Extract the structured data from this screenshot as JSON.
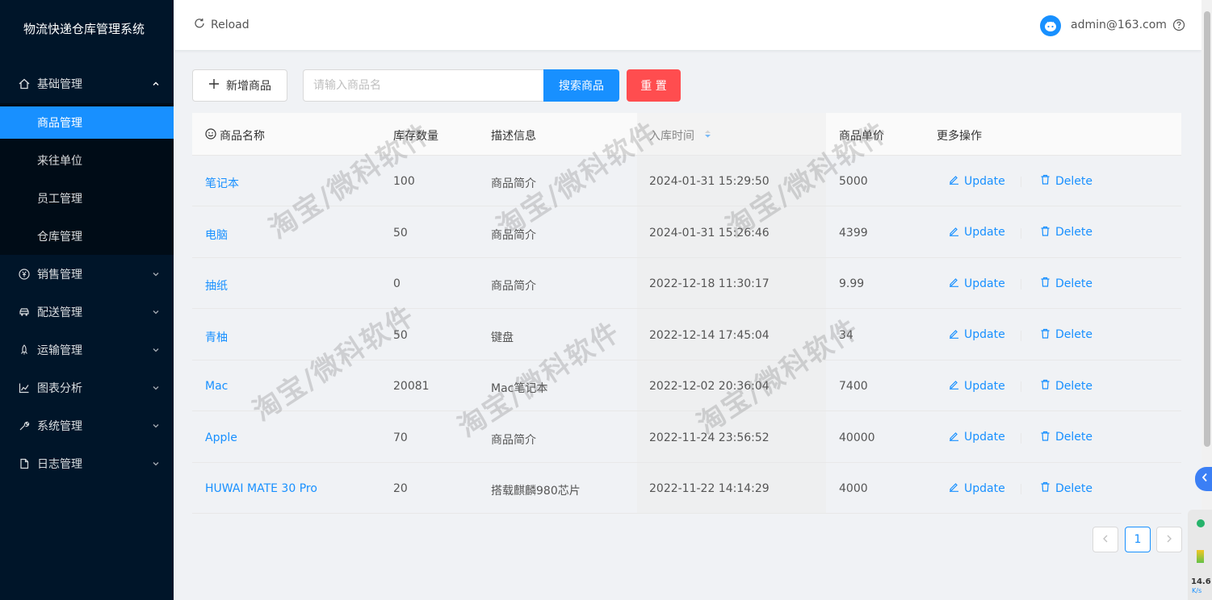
{
  "app": {
    "title": "物流快递仓库管理系统"
  },
  "sidebar": {
    "menus": [
      {
        "label": "基础管理",
        "icon": "home-icon",
        "expanded": true,
        "children": [
          {
            "label": "商品管理",
            "active": true
          },
          {
            "label": "来往单位"
          },
          {
            "label": "员工管理"
          },
          {
            "label": "仓库管理"
          }
        ]
      },
      {
        "label": "销售管理",
        "icon": "yen-icon"
      },
      {
        "label": "配送管理",
        "icon": "car-icon"
      },
      {
        "label": "运输管理",
        "icon": "rocket-icon"
      },
      {
        "label": "图表分析",
        "icon": "line-chart-icon"
      },
      {
        "label": "系统管理",
        "icon": "tool-icon"
      },
      {
        "label": "日志管理",
        "icon": "file-icon"
      }
    ]
  },
  "header": {
    "reload_label": "Reload",
    "user_email": "admin@163.com"
  },
  "toolbar": {
    "add_label": "新增商品",
    "search_placeholder": "请输入商品名",
    "search_label": "搜索商品",
    "reset_label": "重 置"
  },
  "table": {
    "columns": [
      "商品名称",
      "库存数量",
      "描述信息",
      "入库时间",
      "商品单价",
      "更多操作"
    ],
    "update_label": "Update",
    "delete_label": "Delete",
    "rows": [
      {
        "name": "笔记本",
        "stock": "100",
        "desc": "商品简介",
        "time": "2024-01-31 15:29:50",
        "price": "5000"
      },
      {
        "name": "电脑",
        "stock": "50",
        "desc": "商品简介",
        "time": "2024-01-31 15:26:46",
        "price": "4399"
      },
      {
        "name": "抽纸",
        "stock": "0",
        "desc": "商品简介",
        "time": "2022-12-18 11:30:17",
        "price": "9.99"
      },
      {
        "name": "青柚",
        "stock": "50",
        "desc": "键盘",
        "time": "2022-12-14 17:45:04",
        "price": "34"
      },
      {
        "name": "Mac",
        "stock": "20081",
        "desc": "Mac笔记本",
        "time": "2022-12-02 20:36:04",
        "price": "7400"
      },
      {
        "name": "Apple",
        "stock": "70",
        "desc": "商品简介",
        "time": "2022-11-24 23:56:52",
        "price": "40000"
      },
      {
        "name": "HUWAI MATE 30 Pro",
        "stock": "20",
        "desc": "搭载麒麟980芯片",
        "time": "2022-11-22 14:14:29",
        "price": "4000"
      }
    ]
  },
  "pagination": {
    "current": "1"
  },
  "watermark": {
    "text": "淘宝/微科软件"
  },
  "net_widget": {
    "speed": "14.6",
    "unit": "K/s"
  },
  "colors": {
    "primary": "#1890ff",
    "danger": "#ff4d4f",
    "sidebar": "#001529"
  }
}
